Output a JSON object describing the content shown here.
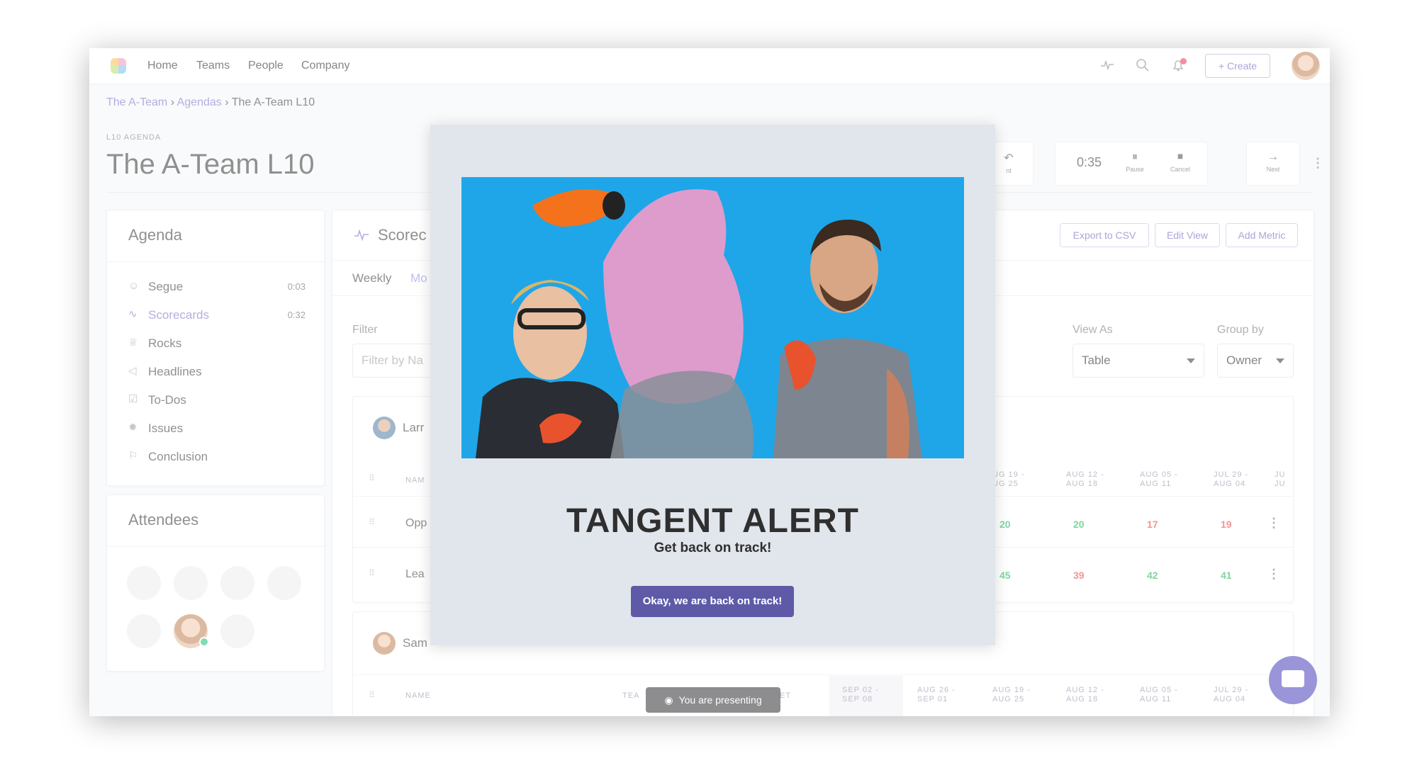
{
  "nav": {
    "links": [
      "Home",
      "Teams",
      "People",
      "Company"
    ],
    "create_label": "+ Create"
  },
  "breadcrumb": {
    "team": "The A-Team",
    "agendas": "Agendas",
    "current": "The A-Team L10",
    "sep": "›"
  },
  "header": {
    "section_label": "L10 AGENDA",
    "title": "The A-Team L10"
  },
  "controls": {
    "partial_label": "nt",
    "timer": "0:35",
    "pause_label": "Pause",
    "cancel_label": "Cancel",
    "next_label": "Next"
  },
  "agenda": {
    "title": "Agenda",
    "items": [
      {
        "label": "Segue",
        "time": "0:03",
        "icon": "users-icon"
      },
      {
        "label": "Scorecards",
        "time": "0:32",
        "icon": "pulse-icon"
      },
      {
        "label": "Rocks",
        "time": "",
        "icon": "trophy-icon"
      },
      {
        "label": "Headlines",
        "time": "",
        "icon": "megaphone-icon"
      },
      {
        "label": "To-Dos",
        "time": "",
        "icon": "checkbox-icon"
      },
      {
        "label": "Issues",
        "time": "",
        "icon": "bug-icon"
      },
      {
        "label": "Conclusion",
        "time": "",
        "icon": "flag-icon"
      }
    ]
  },
  "attendees": {
    "title": "Attendees"
  },
  "scorecard": {
    "title_partial": "Scorec",
    "tabs": [
      "Weekly",
      "Mo"
    ],
    "export_label": "Export to CSV",
    "edit_label": "Edit View",
    "add_label": "Add Metric",
    "filter_label": "Filter",
    "filter_placeholder": "Filter by Na",
    "view_as_label": "View As",
    "view_as_value": "Table",
    "group_by_label": "Group by",
    "group_by_value": "Owner",
    "group1": {
      "owner_partial": "Larr",
      "name_head": "NAM",
      "col_heads": [
        "UG 19 -\nUG 25",
        "AUG 12 -\nAUG 18",
        "AUG 05 -\nAUG 11",
        "JUL 29 -\nAUG 04",
        "JU\nJU"
      ],
      "rows": [
        {
          "name_partial": "Opp",
          "values": [
            "20",
            "20",
            "17",
            "19"
          ],
          "status": [
            "green",
            "green",
            "red",
            "red"
          ]
        },
        {
          "name_partial": "Lea",
          "values": [
            "45",
            "39",
            "42",
            "41"
          ],
          "status": [
            "green",
            "red",
            "green",
            "green"
          ]
        }
      ]
    },
    "group2": {
      "owner_partial": "Sam",
      "name_head": "NAME",
      "team_head": "TEA",
      "target_head": "ET",
      "col_heads": [
        "SEP 02 -\nSEP 08",
        "AUG 26 -\nSEP 01",
        "AUG 19 -\nAUG 25",
        "AUG 12 -\nAUG 18",
        "AUG 05 -\nAUG 11",
        "JUL 29 -\nAUG 04"
      ]
    }
  },
  "modal": {
    "title": "TANGENT ALERT",
    "subtitle": "Get back on track!",
    "button_label": "Okay, we are back on track!"
  },
  "presenting_label": "You are presenting"
}
